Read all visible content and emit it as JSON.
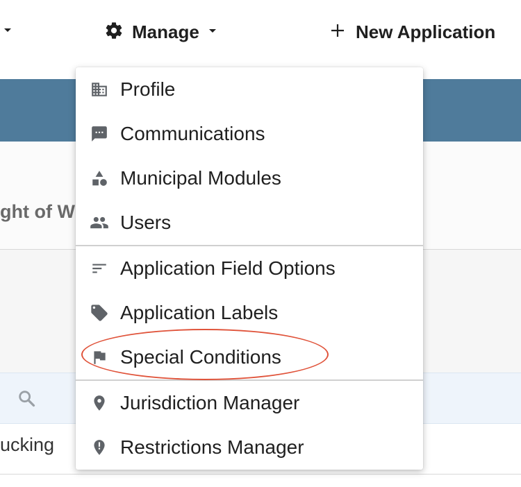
{
  "nav": {
    "manage_label": "Manage",
    "new_application_label": "New Application"
  },
  "page": {
    "title_fragment": "ght of W",
    "row_fragment": "ucking"
  },
  "search": {
    "placeholder": ""
  },
  "menu": {
    "items": [
      {
        "label": "Profile",
        "icon": "building-icon"
      },
      {
        "label": "Communications",
        "icon": "message-icon"
      },
      {
        "label": "Municipal Modules",
        "icon": "shapes-icon"
      },
      {
        "label": "Users",
        "icon": "users-icon"
      },
      {
        "label": "Application Field Options",
        "icon": "sort-lines-icon"
      },
      {
        "label": "Application Labels",
        "icon": "tag-icon"
      },
      {
        "label": "Special Conditions",
        "icon": "flag-icon"
      },
      {
        "label": "Jurisdiction Manager",
        "icon": "location-pin-icon"
      },
      {
        "label": "Restrictions Manager",
        "icon": "alert-pin-icon"
      }
    ],
    "highlighted_item": "Special Conditions"
  },
  "colors": {
    "banner": "#4f7b9b",
    "icon": "#5f6368",
    "highlight": "#e0533a"
  }
}
